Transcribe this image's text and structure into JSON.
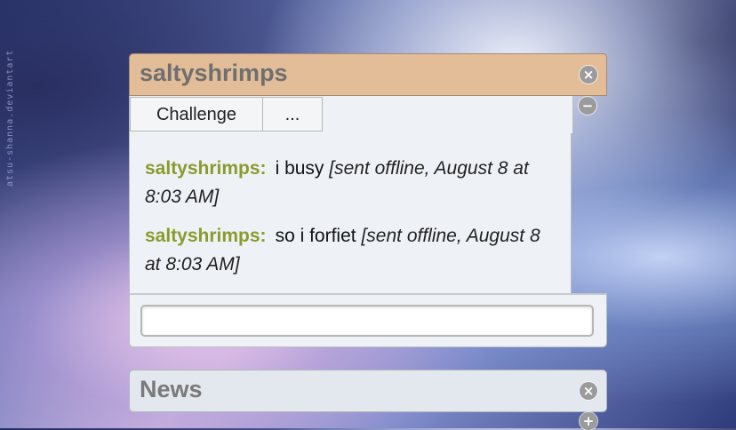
{
  "watermark": "atsu-shanna.deviantart",
  "pm_window": {
    "title": "saltyshrimps",
    "close_icon": "×",
    "minimize_icon": "−",
    "buttons": {
      "challenge": "Challenge",
      "more": "..."
    },
    "messages": [
      {
        "user": "saltyshrimps:",
        "text": "i busy",
        "time": "[sent offline, August 8 at 8:03 AM]"
      },
      {
        "user": "saltyshrimps:",
        "text": "so i forfiet",
        "time": "[sent offline, August 8 at 8:03 AM]"
      }
    ],
    "input_value": ""
  },
  "news_window": {
    "title": "News",
    "close_icon": "×",
    "expand_icon": "+"
  }
}
